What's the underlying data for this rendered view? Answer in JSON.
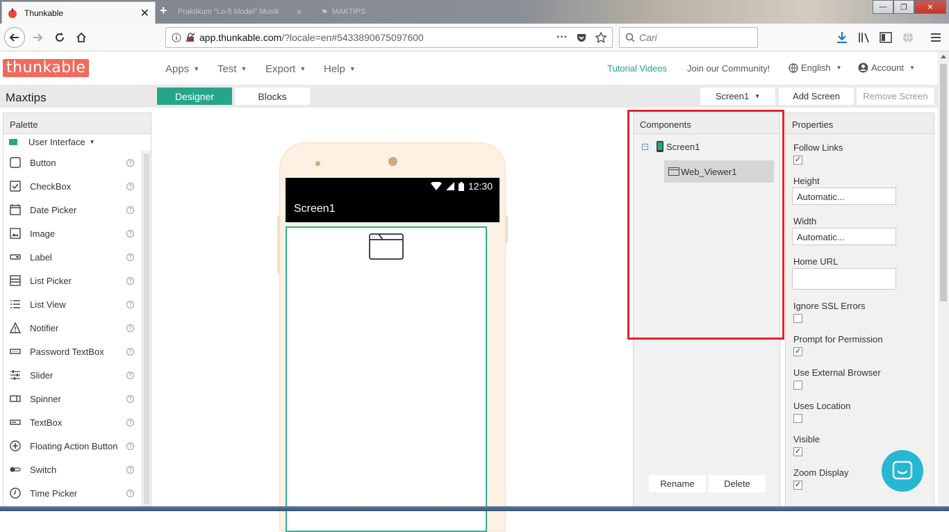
{
  "browser": {
    "active_tab_title": "Thunkable",
    "ghost_tab_1": "Praktikum \"Lo-fi Model\" Musik",
    "ghost_tab_2": "MAKTIPS",
    "url_host": "app.thunkable.com",
    "url_rest": "/?locale=en#5433890675097600",
    "search_placeholder": "Cari",
    "url_more": "···"
  },
  "header": {
    "logo": "thunkable",
    "menus": [
      "Apps",
      "Test",
      "Export",
      "Help"
    ],
    "tutorial": "Tutorial Videos",
    "community": "Join our Community!",
    "language": "English",
    "account": "Account"
  },
  "toolbar": {
    "project": "Maxtips",
    "designer": "Designer",
    "blocks": "Blocks",
    "screen": "Screen1",
    "add_screen": "Add Screen",
    "remove_screen": "Remove Screen"
  },
  "palette": {
    "title": "Palette",
    "category": "User Interface",
    "items": [
      {
        "label": "Button",
        "icon": "button-icon"
      },
      {
        "label": "CheckBox",
        "icon": "checkbox-icon"
      },
      {
        "label": "Date Picker",
        "icon": "calendar-icon"
      },
      {
        "label": "Image",
        "icon": "image-icon"
      },
      {
        "label": "Label",
        "icon": "label-icon"
      },
      {
        "label": "List Picker",
        "icon": "list-picker-icon"
      },
      {
        "label": "List View",
        "icon": "list-view-icon"
      },
      {
        "label": "Notifier",
        "icon": "warning-icon"
      },
      {
        "label": "Password TextBox",
        "icon": "password-icon"
      },
      {
        "label": "Slider",
        "icon": "slider-icon"
      },
      {
        "label": "Spinner",
        "icon": "spinner-icon"
      },
      {
        "label": "TextBox",
        "icon": "textbox-icon"
      },
      {
        "label": "Floating Action Button",
        "icon": "plus-circle-icon"
      },
      {
        "label": "Switch",
        "icon": "switch-icon"
      },
      {
        "label": "Time Picker",
        "icon": "clock-icon"
      }
    ],
    "help_glyph": "?"
  },
  "phone": {
    "time": "12:30",
    "screen_title": "Screen1"
  },
  "components": {
    "title": "Components",
    "root": "Screen1",
    "child": "Web_Viewer1",
    "rename": "Rename",
    "delete": "Delete"
  },
  "properties": {
    "title": "Properties",
    "follow_links": "Follow Links",
    "height": "Height",
    "height_value": "Automatic...",
    "width": "Width",
    "width_value": "Automatic...",
    "home_url": "Home URL",
    "home_url_value": "",
    "ignore_ssl": "Ignore SSL Errors",
    "prompt_permission": "Prompt for Permission",
    "use_external": "Use External Browser",
    "uses_location": "Uses Location",
    "visible": "Visible",
    "zoom_display": "Zoom Display"
  },
  "checks": {
    "follow_links": "✓",
    "ignore_ssl": "",
    "prompt_permission": "✓",
    "use_external": "",
    "uses_location": "",
    "visible": "✓",
    "zoom_display": "✓"
  },
  "colors": {
    "accent": "#26a689",
    "logo": "#f06a5d",
    "highlight": "#e0252c",
    "chat": "#26b7d3"
  }
}
